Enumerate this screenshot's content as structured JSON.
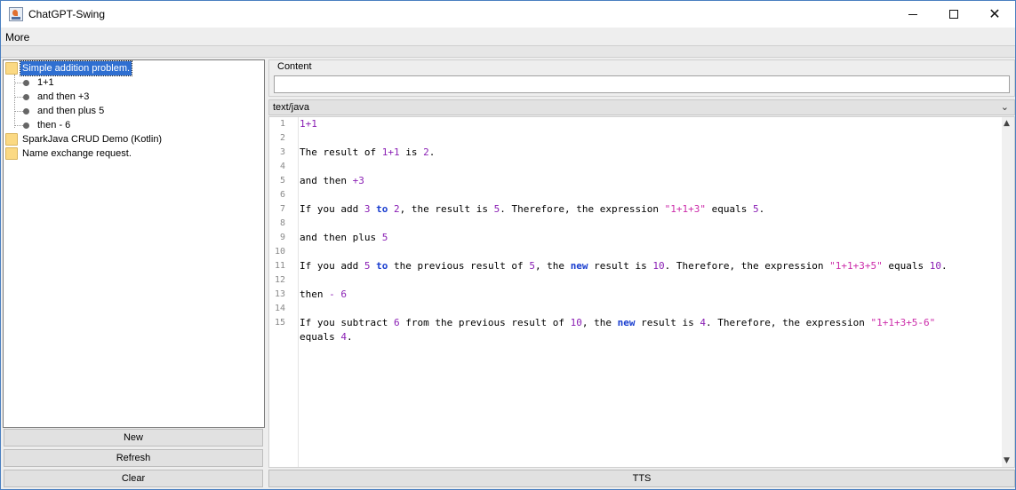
{
  "window": {
    "title": "ChatGPT-Swing",
    "app_icon": "java-cup-icon"
  },
  "controls": {
    "minimize": "minimize-icon",
    "maximize": "maximize-icon",
    "close": "close-icon"
  },
  "menu": {
    "more": "More"
  },
  "tree": {
    "items": [
      {
        "label": "Simple addition problem.",
        "type": "folder",
        "selected": true,
        "children": [
          "1+1",
          "and then +3",
          "and then plus 5",
          "then - 6"
        ]
      },
      {
        "label": "SparkJava CRUD Demo (Kotlin)",
        "type": "folder"
      },
      {
        "label": "Name exchange request.",
        "type": "folder"
      }
    ]
  },
  "sidebar_buttons": {
    "new": "New",
    "refresh": "Refresh",
    "clear": "Clear"
  },
  "content": {
    "legend": "Content",
    "value": ""
  },
  "mime_select": {
    "selected": "text/java"
  },
  "editor": {
    "line_numbers": [
      "1",
      "2",
      "3",
      "4",
      "5",
      "6",
      "7",
      "8",
      "9",
      "10",
      "11",
      "12",
      "13",
      "14",
      "15"
    ],
    "lines": [
      "1+1",
      "",
      "The result of 1+1 is 2.",
      "",
      "and then +3",
      "",
      "If you add 3 to 2, the result is 5. Therefore, the expression \"1+1+3\" equals 5.",
      "",
      "and then plus 5",
      "",
      "If you add 5 to the previous result of 5, the new result is 10. Therefore, the expression \"1+1+3+5\" equals 10.",
      "",
      "then - 6",
      "",
      "If you subtract 6 from the previous result of 10, the new result is 4. Therefore, the expression \"1+1+3+5-6\"",
      "equals 4."
    ]
  },
  "tts_button": "TTS",
  "colors": {
    "selection": "#2f6fd1",
    "number": "#8a1fb4",
    "string": "#cc2daa",
    "keyword": "#1a3ecf",
    "folder": "#fbd983"
  }
}
